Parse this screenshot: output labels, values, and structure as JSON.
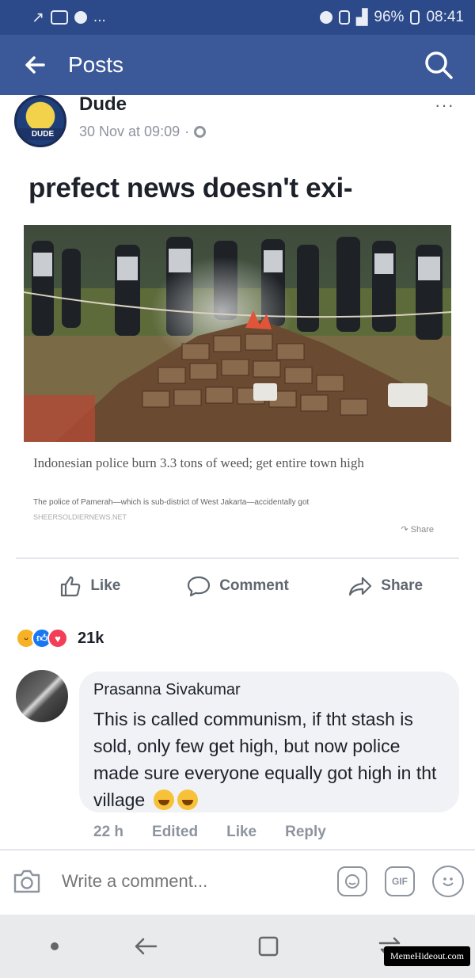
{
  "status_bar": {
    "battery": "96%",
    "time": "08:41",
    "overflow": "..."
  },
  "app_bar": {
    "title": "Posts"
  },
  "post": {
    "author": "Dude",
    "avatar_badge": "DUDE",
    "timestamp": "30 Nov at 09:09",
    "text": "prefect news doesn't exi-",
    "more": "···"
  },
  "link_preview": {
    "title": "Indonesian police burn 3.3 tons of weed; get entire town high",
    "description": "The police of Pamerah—which is sub-district of West Jakarta—accidentally got",
    "source": "SHEERSOLDIERNEWS.NET",
    "share_label": "Share"
  },
  "actions": {
    "like": "Like",
    "comment": "Comment",
    "share": "Share"
  },
  "reactions": {
    "count": "21k"
  },
  "comment": {
    "author": "Prasanna Sivakumar",
    "text": "This is called communism, if tht stash is sold, only few get high, but now police made sure everyone equally got high in tht village",
    "time": "22 h",
    "edited": "Edited",
    "like": "Like",
    "reply": "Reply"
  },
  "composer": {
    "placeholder": "Write a comment...",
    "gif": "GIF"
  },
  "watermark": "MemeHideout.com",
  "colors": {
    "facebook_blue": "#3b5998",
    "status_bar": "#2c4a8a",
    "secondary_text": "#8d949e"
  }
}
